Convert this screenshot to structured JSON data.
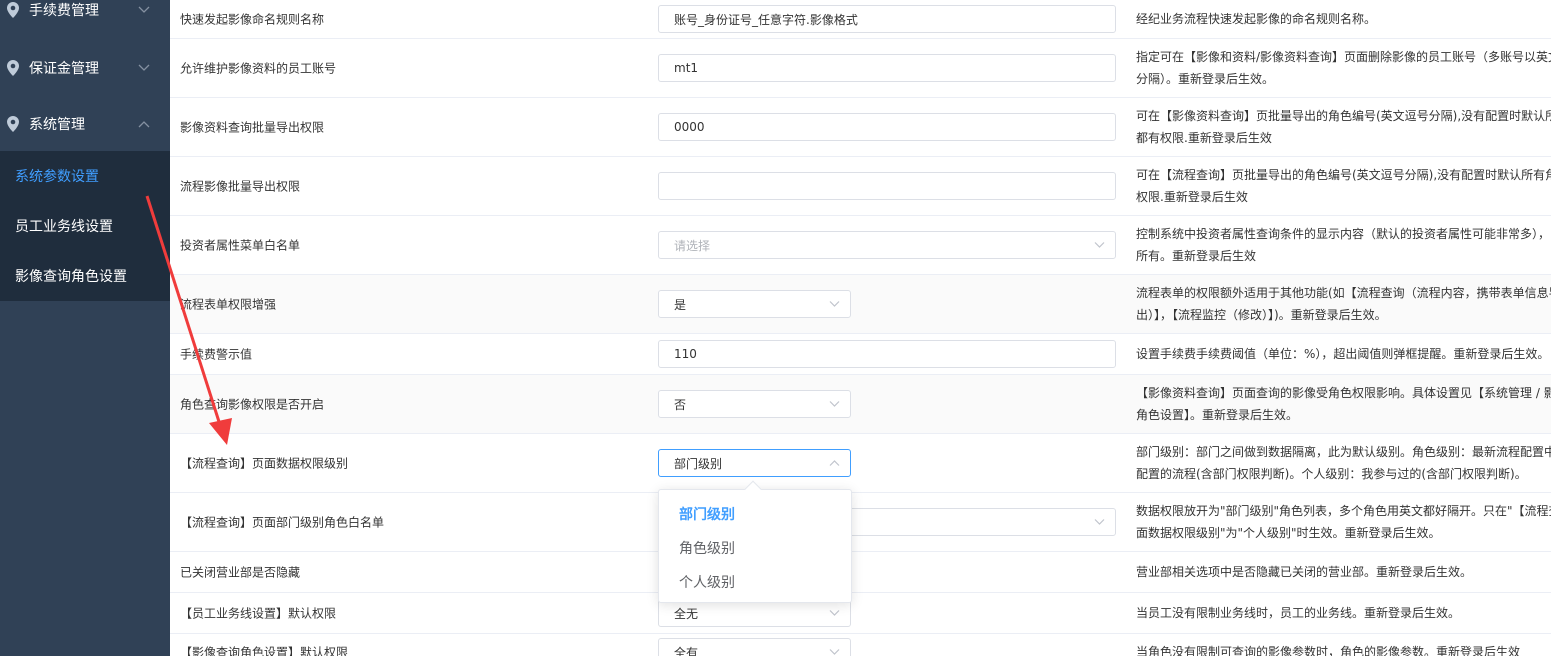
{
  "sidebar": {
    "menus": [
      {
        "label": "手续费管理",
        "icon": "location-pin-icon",
        "expanded": false
      },
      {
        "label": "保证金管理",
        "icon": "location-pin-icon",
        "expanded": false
      },
      {
        "label": "系统管理",
        "icon": "location-pin-icon",
        "expanded": true
      }
    ],
    "submenu": [
      {
        "label": "系统参数设置",
        "active": true
      },
      {
        "label": "员工业务线设置",
        "active": false
      },
      {
        "label": "影像查询角色设置",
        "active": false
      }
    ]
  },
  "params": [
    {
      "name": "快速发起影像命名规则名称",
      "control": "input",
      "value": "账号_身份证号_任意字符.影像格式",
      "desc": [
        "经纪业务流程快速发起影像的命名规则名称。"
      ]
    },
    {
      "name": "允许维护影像资料的员工账号",
      "control": "input",
      "value": "mt1",
      "desc": [
        "指定可在【影像和资料/影像资料查询】页面删除影像的员工账号（多账号以英文",
        "分隔）。重新登录后生效。"
      ]
    },
    {
      "name": "影像资料查询批量导出权限",
      "control": "input",
      "value": "0000",
      "desc": [
        "可在【影像资料查询】页批量导出的角色编号(英文逗号分隔),没有配置时默认所",
        "都有权限.重新登录后生效"
      ]
    },
    {
      "name": "流程影像批量导出权限",
      "control": "input",
      "value": "",
      "desc": [
        "可在【流程查询】页批量导出的角色编号(英文逗号分隔),没有配置时默认所有角",
        "权限.重新登录后生效"
      ]
    },
    {
      "name": "投资者属性菜单白名单",
      "control": "select-wide",
      "value": "",
      "placeholder": "请选择",
      "desc": [
        "控制系统中投资者属性查询条件的显示内容（默认的投资者属性可能非常多），",
        "所有。重新登录后生效"
      ]
    },
    {
      "name": "流程表单权限增强",
      "control": "select",
      "value": "是",
      "desc": [
        "流程表单的权限额外适用于其他功能(如【流程查询（流程内容，携带表单信息导",
        "出）】，【流程监控（修改）】)。重新登录后生效。"
      ]
    },
    {
      "name": "手续费警示值",
      "control": "input",
      "value": "110",
      "desc": [
        "设置手续费手续费阈值（单位：%），超出阈值则弹框提醒。重新登录后生效。"
      ]
    },
    {
      "name": "角色查询影像权限是否开启",
      "control": "select",
      "value": "否",
      "desc": [
        "【影像资料查询】页面查询的影像受角色权限影响。具体设置见【系统管理 / 影",
        "角色设置】。重新登录后生效。"
      ]
    },
    {
      "name": "【流程查询】页面数据权限级别",
      "control": "select-open",
      "value": "部门级别",
      "desc": [
        "部门级别：部门之间做到数据隔离，此为默认级别。角色级别：最新流程配置中",
        "配置的流程(含部门权限判断)。个人级别：我参与过的(含部门权限判断)。"
      ]
    },
    {
      "name": "【流程查询】页面部门级别角色白名单",
      "control": "select-wide",
      "value": "",
      "placeholder": "",
      "desc": [
        "数据权限放开为\"部门级别\"角色列表，多个角色用英文都好隔开。只在\"【流程查",
        "面数据权限级别\"为\"个人级别\"时生效。重新登录后生效。"
      ]
    },
    {
      "name": "已关闭营业部是否隐藏",
      "control": "none",
      "value": "",
      "desc": [
        "营业部相关选项中是否隐藏已关闭的营业部。重新登录后生效。"
      ]
    },
    {
      "name": "【员工业务线设置】默认权限",
      "control": "select",
      "value": "全无",
      "desc": [
        "当员工没有限制业务线时，员工的业务线。重新登录后生效。"
      ]
    },
    {
      "name": "【影像查询角色设置】默认权限",
      "control": "select",
      "value": "全有",
      "desc": [
        "当角色没有限制可查询的影像参数时，角色的影像参数。重新登录后生效"
      ]
    }
  ],
  "dropdown": {
    "options": [
      "部门级别",
      "角色级别",
      "个人级别"
    ],
    "selected": "部门级别"
  },
  "colors": {
    "sidebar_bg": "#304156",
    "submenu_bg": "#1f2d3d",
    "accent": "#409eff",
    "annotation_arrow": "#f03c3c"
  }
}
